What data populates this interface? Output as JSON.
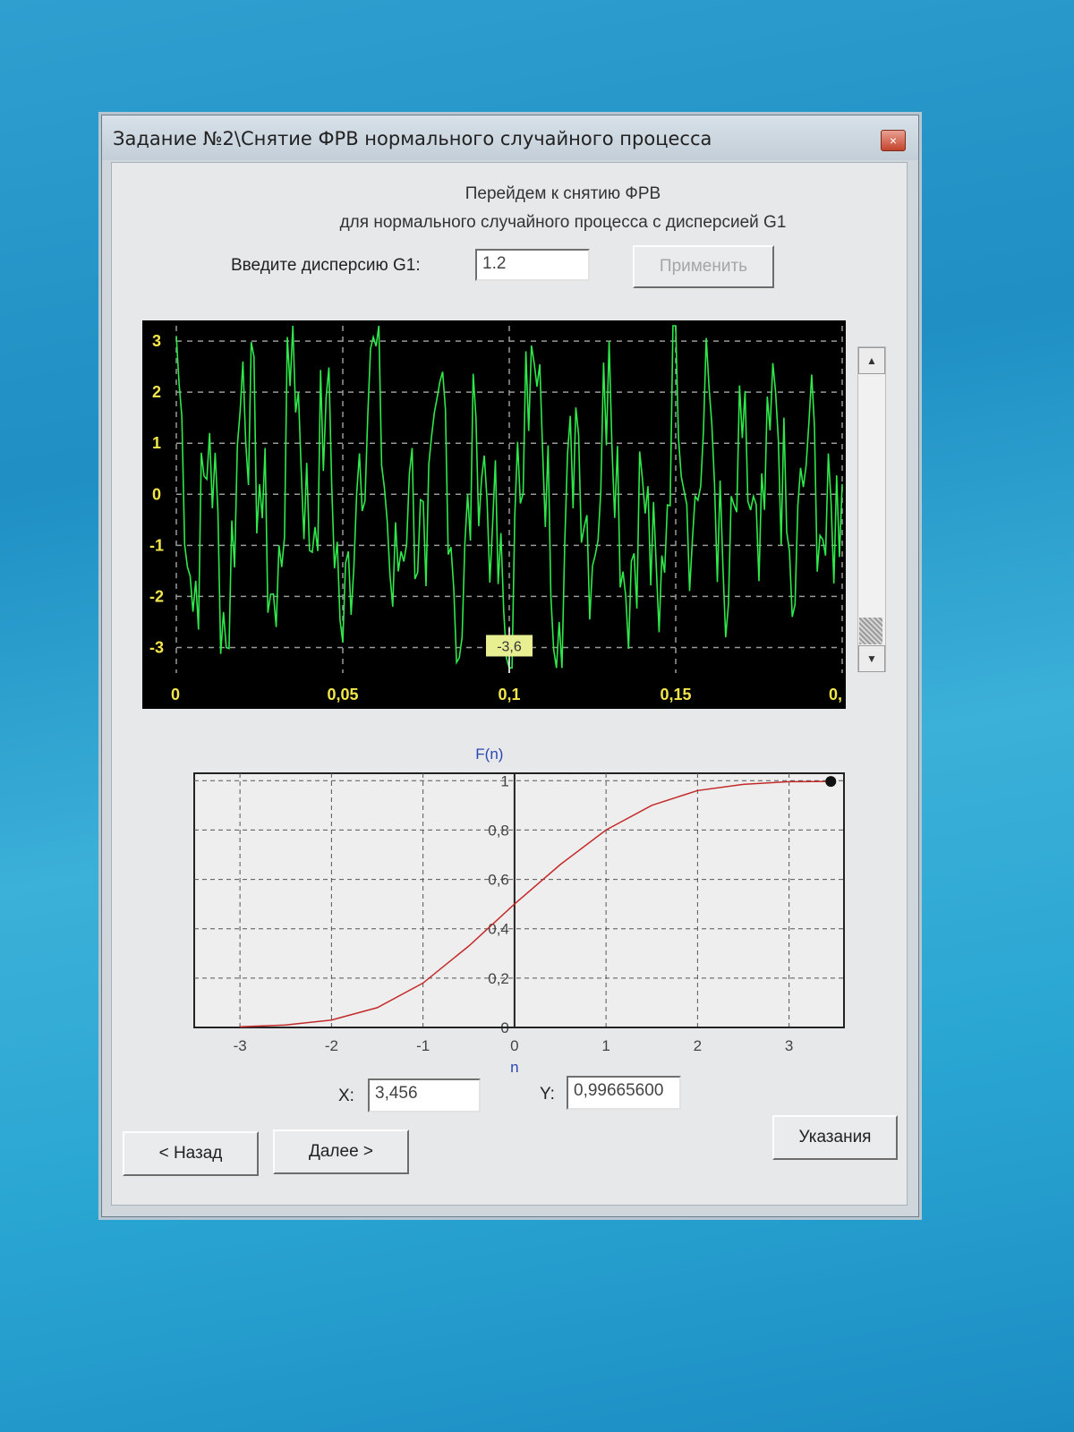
{
  "window": {
    "title": "Задание №2\\Снятие ФРВ нормального случайного процесса",
    "close_glyph": "×"
  },
  "intro": {
    "line1": "Перейдем к снятию ФРВ",
    "line2": "для нормального случайного процесса с дисперсией G1"
  },
  "variance": {
    "label": "Введите дисперсию G1:",
    "value": "1.2",
    "apply_label": "Применить"
  },
  "scope": {
    "y_ticks": [
      "3",
      "2",
      "1",
      "0",
      "-1",
      "-2",
      "-3"
    ],
    "x_ticks": [
      "0",
      "0,05",
      "0,1",
      "0,15",
      "0,"
    ],
    "marker_label": "-3,6",
    "line_color": "#2fe84a"
  },
  "cdf_chart": {
    "ylabel": "F(n)",
    "xlabel": "n",
    "x_ticks": [
      "-3",
      "-2",
      "-1",
      "0",
      "1",
      "2",
      "3"
    ],
    "y_ticks": [
      "0",
      "0,2",
      "0,4",
      "0,6",
      "0,8",
      "1"
    ],
    "curve_color": "#c42a2a"
  },
  "chart_data": [
    {
      "type": "line",
      "xlim": [
        0,
        0.2
      ],
      "ylim": [
        -3.5,
        3.3
      ],
      "series": [
        {
          "x": [
            0,
            0.005,
            0.01,
            0.015,
            0.02,
            0.025,
            0.03,
            0.035,
            0.04,
            0.045,
            0.05,
            0.055,
            0.06,
            0.065,
            0.07,
            0.075,
            0.08,
            0.085,
            0.09,
            0.095,
            0.1,
            0.105,
            0.11,
            0.115,
            0.12,
            0.125,
            0.13,
            0.135,
            0.14,
            0.145,
            0.15,
            0.155,
            0.16,
            0.165,
            0.17,
            0.175,
            0.18,
            0.185,
            0.19,
            0.195,
            0.2
          ],
          "y": [
            3.1,
            -2.3,
            1.2,
            -3.0,
            2.6,
            0.2,
            -2.6,
            3.3,
            -1.1,
            1.9,
            -2.9,
            0.8,
            2.9,
            -2.2,
            0.4,
            -1.8,
            2.4,
            -3.2,
            1.5,
            -0.6,
            -3.6,
            2.8,
            0.9,
            -2.5,
            1.7,
            -1.4,
            3.0,
            -2.0,
            0.3,
            -2.7,
            3.3,
            -0.9,
            2.1,
            -2.8,
            1.1,
            -1.7,
            2.0,
            -2.4,
            1.4,
            -1.2,
            0.2
          ]
        }
      ],
      "annotations": [
        "-3,6"
      ]
    },
    {
      "type": "line",
      "xlabel": "n",
      "ylabel": "F(n)",
      "xlim": [
        -3.5,
        3.6
      ],
      "ylim": [
        0,
        1.03
      ],
      "grid": true,
      "series": [
        {
          "x": [
            -3.0,
            -2.5,
            -2.0,
            -1.5,
            -1.0,
            -0.5,
            0.0,
            0.5,
            1.0,
            1.5,
            2.0,
            2.5,
            3.0,
            3.456
          ],
          "y": [
            0.003,
            0.01,
            0.03,
            0.08,
            0.18,
            0.33,
            0.5,
            0.66,
            0.8,
            0.9,
            0.96,
            0.985,
            0.996,
            0.997
          ]
        }
      ],
      "annotations": [
        "X: 3,456",
        "Y: 0,99665600"
      ]
    }
  ],
  "coords": {
    "x_label": "X:",
    "x_value": "3,456",
    "y_label": "Y:",
    "y_value": "0,99665600"
  },
  "nav": {
    "back_label": "< Назад",
    "next_label": "Далее >",
    "hints_label": "Указания"
  }
}
